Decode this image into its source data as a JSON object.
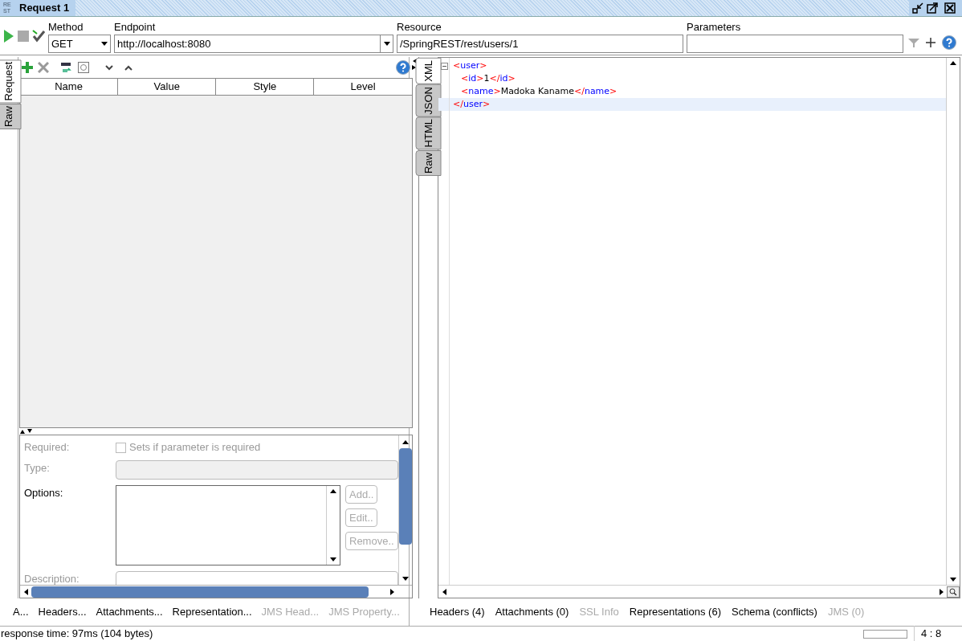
{
  "window": {
    "title": "Request 1",
    "app_badge": "RE ST"
  },
  "toolbar": {
    "method": {
      "label": "Method",
      "value": "GET"
    },
    "endpoint": {
      "label": "Endpoint",
      "value": "http://localhost:8080"
    },
    "resource": {
      "label": "Resource",
      "value": "/SpringREST/rest/users/1"
    },
    "parameters": {
      "label": "Parameters"
    }
  },
  "request_tabs": [
    {
      "label": "Request",
      "selected": true
    },
    {
      "label": "Raw",
      "selected": false
    }
  ],
  "params_table": {
    "columns": [
      "Name",
      "Value",
      "Style",
      "Level"
    ]
  },
  "param_details": {
    "rows": [
      {
        "kind": "checkbox",
        "label": "Required:",
        "text": "Sets if parameter is required",
        "checked": false,
        "disabled": true
      },
      {
        "kind": "field",
        "label": "Type:",
        "disabled": true
      },
      {
        "kind": "list",
        "label": "Options:",
        "disabled": false,
        "buttons": [
          {
            "label": "Add..",
            "disabled": true
          },
          {
            "label": "Edit..",
            "disabled": true
          },
          {
            "label": "Remove..",
            "disabled": true
          }
        ]
      },
      {
        "kind": "field",
        "label": "Description:",
        "disabled": true
      }
    ]
  },
  "request_bottom_tabs": [
    {
      "label": "A...",
      "disabled": false
    },
    {
      "label": "Headers...",
      "disabled": false
    },
    {
      "label": "Attachments...",
      "disabled": false
    },
    {
      "label": "Representation...",
      "disabled": false
    },
    {
      "label": "JMS Head...",
      "disabled": true
    },
    {
      "label": "JMS Property...",
      "disabled": true
    }
  ],
  "response_tabs": [
    {
      "label": "XML",
      "selected": true
    },
    {
      "label": "JSON",
      "selected": false
    },
    {
      "label": "HTML",
      "selected": false
    },
    {
      "label": "Raw",
      "selected": false
    }
  ],
  "xml_lines": [
    {
      "parts": [
        {
          "kind": "punct",
          "text": "<"
        },
        {
          "kind": "tag",
          "text": "user"
        },
        {
          "kind": "punct",
          "text": ">"
        }
      ],
      "children": [
        {
          "parts": [
            {
              "kind": "punct",
              "text": "<"
            },
            {
              "kind": "tag",
              "text": "id"
            },
            {
              "kind": "punct",
              "text": ">"
            },
            {
              "kind": "text",
              "text": "1"
            },
            {
              "kind": "punct",
              "text": "</"
            },
            {
              "kind": "tag",
              "text": "id"
            },
            {
              "kind": "punct",
              "text": ">"
            }
          ]
        },
        {
          "parts": [
            {
              "kind": "punct",
              "text": "<"
            },
            {
              "kind": "tag",
              "text": "name"
            },
            {
              "kind": "punct",
              "text": ">"
            },
            {
              "kind": "text",
              "text": "Madoka Kaname"
            },
            {
              "kind": "punct",
              "text": "</"
            },
            {
              "kind": "tag",
              "text": "name"
            },
            {
              "kind": "punct",
              "text": ">"
            }
          ]
        }
      ]
    },
    {
      "parts": [
        {
          "kind": "punct",
          "text": "</"
        },
        {
          "kind": "tag",
          "text": "user"
        },
        {
          "kind": "punct",
          "text": ">"
        }
      ],
      "selected": true
    }
  ],
  "response_bottom_tabs": [
    {
      "label": "Headers (4)",
      "disabled": false
    },
    {
      "label": "Attachments (0)",
      "disabled": false
    },
    {
      "label": "SSL Info",
      "disabled": true
    },
    {
      "label": "Representations (6)",
      "disabled": false
    },
    {
      "label": "Schema (conflicts)",
      "disabled": false
    },
    {
      "label": "JMS (0)",
      "disabled": true
    }
  ],
  "status_bar": {
    "response_time": "response time: 97ms (104 bytes)",
    "position": "4 : 8"
  }
}
